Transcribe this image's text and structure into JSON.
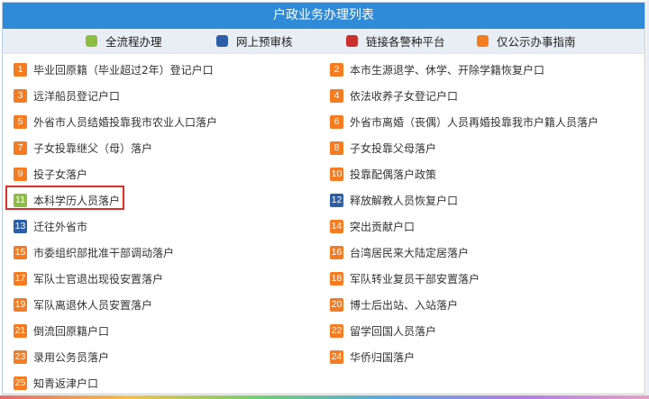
{
  "title": "户政业务办理列表",
  "legend": [
    {
      "label": "全流程办理",
      "color": "#8cbf3f",
      "icon": "green-square-icon"
    },
    {
      "label": "网上预审核",
      "color": "#2d5ea8",
      "icon": "blue-square-icon"
    },
    {
      "label": "链接各警种平台",
      "color": "#c9302c",
      "icon": "red-square-icon"
    },
    {
      "label": "仅公示办事指南",
      "color": "#f57c20",
      "icon": "orange-square-icon"
    }
  ],
  "items": [
    {
      "num": "1",
      "label": "毕业回原籍（毕业超过2年）登记户口",
      "color": "#f57c20"
    },
    {
      "num": "2",
      "label": "本市生源退学、休学、开除学籍恢复户口",
      "color": "#f57c20"
    },
    {
      "num": "3",
      "label": "远洋船员登记户口",
      "color": "#f57c20"
    },
    {
      "num": "4",
      "label": "依法收养子女登记户口",
      "color": "#f57c20"
    },
    {
      "num": "5",
      "label": "外省市人员结婚投靠我市农业人口落户",
      "color": "#f57c20"
    },
    {
      "num": "6",
      "label": "外省市离婚（丧偶）人员再婚投靠我市户籍人员落户",
      "color": "#f57c20"
    },
    {
      "num": "7",
      "label": "子女投靠继父（母）落户",
      "color": "#f57c20"
    },
    {
      "num": "8",
      "label": "子女投靠父母落户",
      "color": "#f57c20"
    },
    {
      "num": "9",
      "label": "投子女落户",
      "color": "#f57c20"
    },
    {
      "num": "10",
      "label": "投靠配偶落户政策",
      "color": "#f57c20"
    },
    {
      "num": "11",
      "label": "本科学历人员落户",
      "color": "#8cbf3f"
    },
    {
      "num": "12",
      "label": "释放解教人员恢复户口",
      "color": "#2d5ea8"
    },
    {
      "num": "13",
      "label": "迁往外省市",
      "color": "#2d5ea8"
    },
    {
      "num": "14",
      "label": "突出贡献户口",
      "color": "#f57c20"
    },
    {
      "num": "15",
      "label": "市委组织部批准干部调动落户",
      "color": "#f57c20"
    },
    {
      "num": "16",
      "label": "台湾居民来大陆定居落户",
      "color": "#f57c20"
    },
    {
      "num": "17",
      "label": "军队士官退出现役安置落户",
      "color": "#f57c20"
    },
    {
      "num": "18",
      "label": "军队转业复员干部安置落户",
      "color": "#f57c20"
    },
    {
      "num": "19",
      "label": "军队离退休人员安置落户",
      "color": "#f57c20"
    },
    {
      "num": "20",
      "label": "博士后出站、入站落户",
      "color": "#f57c20"
    },
    {
      "num": "21",
      "label": "倒流回原籍户口",
      "color": "#f57c20"
    },
    {
      "num": "22",
      "label": "留学回国人员落户",
      "color": "#f57c20"
    },
    {
      "num": "23",
      "label": "录用公务员落户",
      "color": "#f57c20"
    },
    {
      "num": "24",
      "label": "华侨归国落户",
      "color": "#f57c20"
    },
    {
      "num": "25",
      "label": "知青返津户口",
      "color": "#f57c20"
    }
  ]
}
